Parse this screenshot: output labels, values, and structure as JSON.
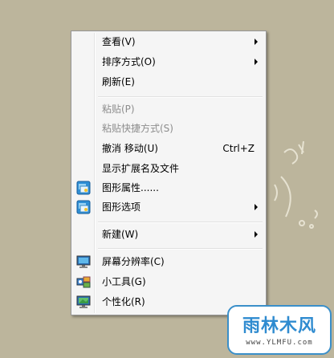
{
  "menu": {
    "items": [
      {
        "label": "查看(V)",
        "submenu": true
      },
      {
        "label": "排序方式(O)",
        "submenu": true
      },
      {
        "label": "刷新(E)"
      },
      {
        "label": "粘贴(P)",
        "disabled": true
      },
      {
        "label": "粘贴快捷方式(S)",
        "disabled": true
      },
      {
        "label": "撤消 移动(U)",
        "shortcut": "Ctrl+Z"
      },
      {
        "label": "显示扩展名及文件"
      },
      {
        "label": "图形属性......",
        "icon": "graphics-properties-icon"
      },
      {
        "label": "图形选项",
        "submenu": true,
        "icon": "graphics-options-icon"
      },
      {
        "label": "新建(W)",
        "submenu": true
      },
      {
        "label": "屏幕分辨率(C)",
        "icon": "screen-resolution-icon"
      },
      {
        "label": "小工具(G)",
        "icon": "gadgets-icon"
      },
      {
        "label": "个性化(R)",
        "icon": "personalize-icon"
      }
    ]
  },
  "watermark": {
    "title": "雨林木风",
    "url": "www.YLMFU.com"
  }
}
